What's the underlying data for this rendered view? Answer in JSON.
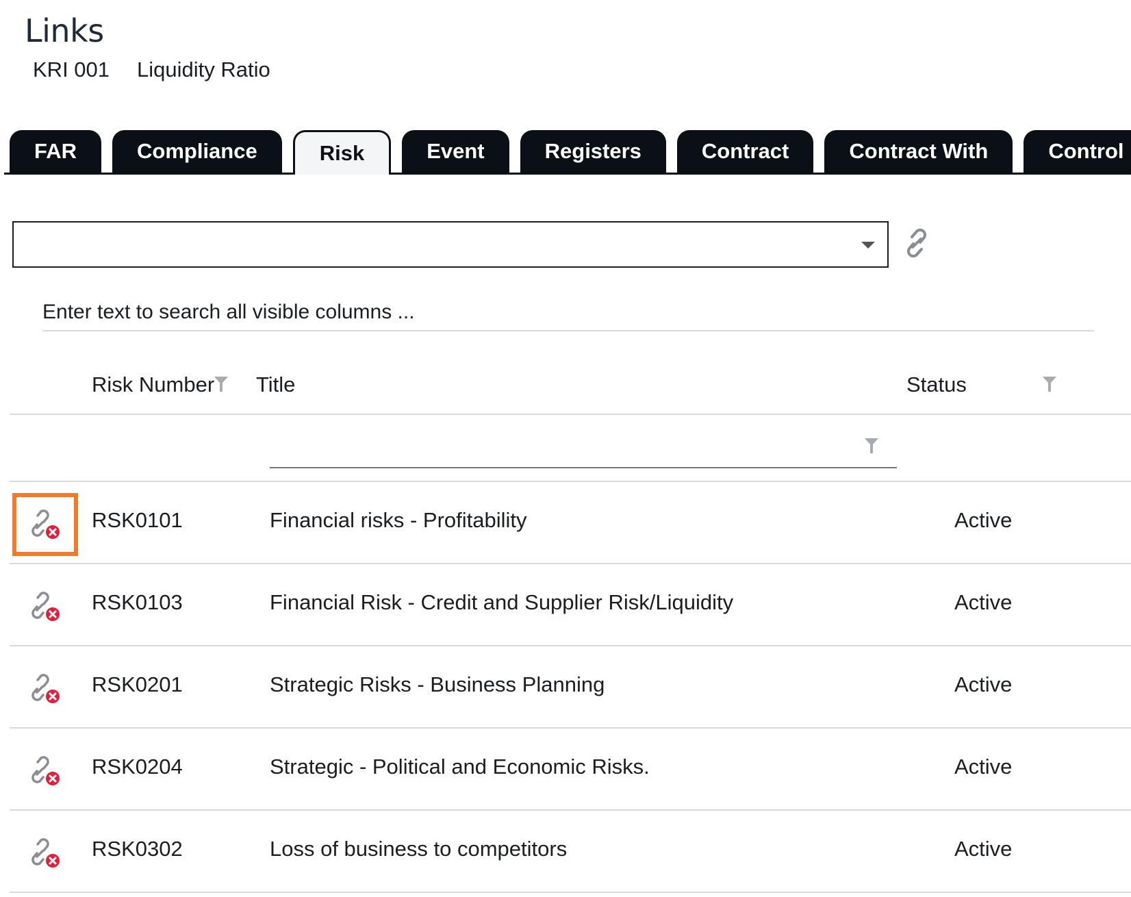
{
  "page": {
    "title": "Links",
    "record_code": "KRI 001",
    "record_name": "Liquidity Ratio"
  },
  "tabs": [
    {
      "label": "FAR",
      "active": false
    },
    {
      "label": "Compliance",
      "active": false
    },
    {
      "label": "Risk",
      "active": true
    },
    {
      "label": "Event",
      "active": false
    },
    {
      "label": "Registers",
      "active": false
    },
    {
      "label": "Contract",
      "active": false
    },
    {
      "label": "Contract With",
      "active": false
    },
    {
      "label": "Control In",
      "active": false
    }
  ],
  "picker": {
    "value": "",
    "caret_icon": "chevron-down-icon",
    "link_icon": "link-icon"
  },
  "search": {
    "placeholder": "Enter text to search all visible columns ..."
  },
  "grid": {
    "columns": {
      "number": "Risk Number",
      "title": "Title",
      "status": "Status"
    },
    "filter_icon": "filter-icon",
    "row_icon": "unlink-icon",
    "rows": [
      {
        "number": "RSK0101",
        "title": "Financial risks - Profitability",
        "status": "Active",
        "selected": true
      },
      {
        "number": "RSK0103",
        "title": "Financial Risk - Credit and Supplier Risk/Liquidity",
        "status": "Active",
        "selected": false
      },
      {
        "number": "RSK0201",
        "title": "Strategic Risks - Business Planning",
        "status": "Active",
        "selected": false
      },
      {
        "number": "RSK0204",
        "title": "Strategic - Political and Economic Risks.",
        "status": "Active",
        "selected": false
      },
      {
        "number": "RSK0302",
        "title": "Loss of business to competitors",
        "status": "Active",
        "selected": false
      }
    ]
  },
  "colors": {
    "tab_bg": "#0b0f16",
    "active_tab_bg": "#f4f5f6",
    "highlight": "#f47a2a",
    "unlink_badge": "#e0203a"
  }
}
